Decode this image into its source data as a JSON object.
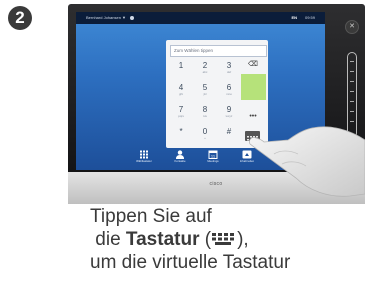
{
  "step_number": "2",
  "topbar": {
    "user_name": "Bernhard Johansen",
    "status": "",
    "right_a": "EN",
    "right_b": "09:59"
  },
  "dialpad": {
    "placeholder": "Zum Wählen tippen",
    "keys": [
      {
        "digit": "1",
        "letters": ""
      },
      {
        "digit": "2",
        "letters": "abc"
      },
      {
        "digit": "3",
        "letters": "def"
      },
      {
        "digit": "4",
        "letters": "ghi"
      },
      {
        "digit": "5",
        "letters": "jkl"
      },
      {
        "digit": "6",
        "letters": "mno"
      },
      {
        "digit": "7",
        "letters": "pqrs"
      },
      {
        "digit": "8",
        "letters": "tuv"
      },
      {
        "digit": "9",
        "letters": "wxyz"
      },
      {
        "digit": "*",
        "letters": ""
      },
      {
        "digit": "0",
        "letters": "+"
      },
      {
        "digit": "#",
        "letters": ""
      }
    ],
    "more_label": "•••"
  },
  "bottom_nav": [
    {
      "label": "Wähltastatur"
    },
    {
      "label": "Kontakte"
    },
    {
      "label": "Meetings"
    },
    {
      "label": "Inhalt teilen"
    }
  ],
  "brand_logo": "cisco",
  "instruction": {
    "line1": "Tippen Sie auf",
    "line2_pre": "die ",
    "line2_bold": "Tastatur",
    "line2_post": " (",
    "line2_end": "),",
    "line3": "um die virtuelle Tastatur"
  },
  "colors": {
    "screen_top": "#3f8ad6",
    "screen_bottom": "#1d4f9a",
    "accent_green": "#b6e27a",
    "text_gray": "#3a3a3a"
  }
}
